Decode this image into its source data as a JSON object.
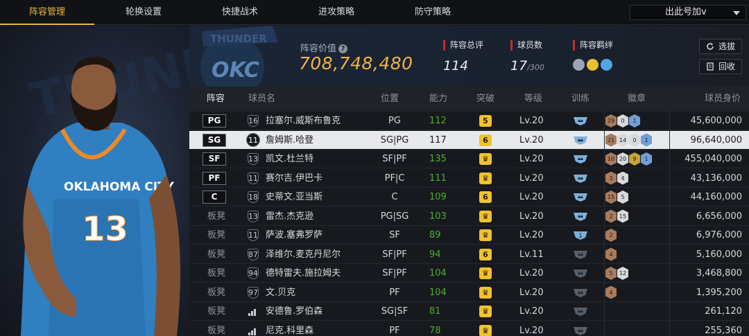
{
  "nav": {
    "tabs": [
      "阵容管理",
      "轮换设置",
      "快捷战术",
      "进攻策略",
      "防守策略"
    ],
    "active_tab": 0,
    "dropdown_label": "出此号加v"
  },
  "team": {
    "logo_text": "OKC",
    "logo_banner": "THUNDER",
    "value_label": "阵容价值",
    "value_number": "708,748,480",
    "rating_label": "阵容总评",
    "rating_value": "114",
    "player_count_label": "球员数",
    "player_count": "17",
    "player_count_max": "/300",
    "bonds_label": "阵容羁绊",
    "select_button": "选拔",
    "recycle_button": "回收"
  },
  "player_card": {
    "jersey_team": "OKLAHOMA CITY",
    "jersey_number": "13"
  },
  "table": {
    "headers": [
      "阵容",
      "球员名",
      "位置",
      "能力",
      "突破",
      "等级",
      "训练",
      "徽章",
      "球员身价"
    ],
    "rows": [
      {
        "slot": "PG",
        "number": "16",
        "name": "拉塞尔.威斯布鲁克",
        "pos": "PG",
        "ability": "112",
        "breakthrough": "5",
        "level": "Lv.20",
        "train": "blue",
        "medals": [
          "29",
          "0",
          "1"
        ],
        "value": "45,600,000"
      },
      {
        "slot": "SG",
        "number": "11",
        "name": "詹姆斯.哈登",
        "pos": "SG|PG",
        "ability": "117",
        "breakthrough": "6",
        "level": "Lv.20",
        "train": "blue",
        "medals": [
          "21",
          "14",
          "0",
          "1"
        ],
        "value": "96,640,000"
      },
      {
        "slot": "SF",
        "number": "13",
        "name": "凯文.杜兰特",
        "pos": "SF|PF",
        "ability": "135",
        "breakthrough": "crown",
        "level": "Lv.20",
        "train": "blue",
        "medals": [
          "10",
          "20",
          "9",
          "1"
        ],
        "value": "455,040,000"
      },
      {
        "slot": "PF",
        "number": "11",
        "name": "赛尔吉.伊巴卡",
        "pos": "PF|C",
        "ability": "111",
        "breakthrough": "crown",
        "level": "Lv.20",
        "train": "blue",
        "medals": [
          "3",
          "4"
        ],
        "value": "43,136,000"
      },
      {
        "slot": "C",
        "number": "18",
        "name": "史蒂文.亚当斯",
        "pos": "C",
        "ability": "109",
        "breakthrough": "6",
        "level": "Lv.20",
        "train": "blue",
        "medals": [
          "15",
          "5"
        ],
        "value": "44,160,000"
      },
      {
        "slot": "板凳",
        "number": "13",
        "name": "雷杰.杰克逊",
        "pos": "PG|SG",
        "ability": "103",
        "breakthrough": "crown",
        "level": "Lv.20",
        "train": "blue",
        "medals": [
          "2",
          "15"
        ],
        "value": "6,656,000"
      },
      {
        "slot": "板凳",
        "number": "11",
        "name": "萨波.塞弗罗萨",
        "pos": "SF",
        "ability": "89",
        "breakthrough": "crown",
        "level": "Lv.20",
        "train": "blue1",
        "medals": [
          "2"
        ],
        "value": "6,976,000"
      },
      {
        "slot": "板凳",
        "number": "87",
        "name": "泽维尔.麦克丹尼尔",
        "pos": "SF|PF",
        "ability": "94",
        "breakthrough": "6",
        "level": "Lv.11",
        "train": "grey",
        "medals": [
          "4"
        ],
        "value": "5,160,000"
      },
      {
        "slot": "板凳",
        "number": "94",
        "name": "德特雷夫.施拉姆夫",
        "pos": "SF|PF",
        "ability": "104",
        "breakthrough": "crown",
        "level": "Lv.20",
        "train": "grey",
        "medals": [
          "5",
          "12"
        ],
        "value": "3,468,800"
      },
      {
        "slot": "板凳",
        "number": "97",
        "name": "文.贝克",
        "pos": "PF",
        "ability": "104",
        "breakthrough": "crown",
        "level": "Lv.20",
        "train": "grey",
        "medals": [
          "4"
        ],
        "value": "1,395,200"
      },
      {
        "slot": "板凳",
        "number": "",
        "name": "安德鲁.罗伯森",
        "pos": "SG|SF",
        "ability": "81",
        "breakthrough": "crown",
        "level": "Lv.20",
        "train": "grey",
        "medals": [],
        "value": "261,120"
      },
      {
        "slot": "板凳",
        "number": "",
        "name": "尼克.科里森",
        "pos": "PF",
        "ability": "78",
        "breakthrough": "crown",
        "level": "Lv.20",
        "train": "grey",
        "medals": [],
        "value": "255,360"
      }
    ]
  },
  "colors": {
    "accent": "#f0b443",
    "ability_green": "#4ab030",
    "badge_yellow": "#f0c22e",
    "stat_marker_red": "#c62d2d"
  }
}
